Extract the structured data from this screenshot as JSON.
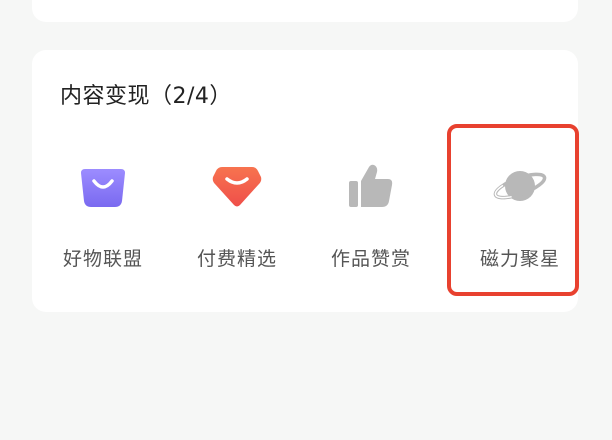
{
  "section": {
    "title": "内容变现（2/4）"
  },
  "items": [
    {
      "label": "好物联盟",
      "icon": "shopping-bag-icon",
      "color": "#8a7bf5"
    },
    {
      "label": "付费精选",
      "icon": "smile-gem-icon",
      "color": "#f2644a"
    },
    {
      "label": "作品赞赏",
      "icon": "thumbs-up-icon",
      "color": "#b8b8b8"
    },
    {
      "label": "磁力聚星",
      "icon": "planet-icon",
      "color": "#b8b8b8"
    }
  ],
  "highlight": {
    "color": "#e8412f",
    "target": "磁力聚星"
  }
}
